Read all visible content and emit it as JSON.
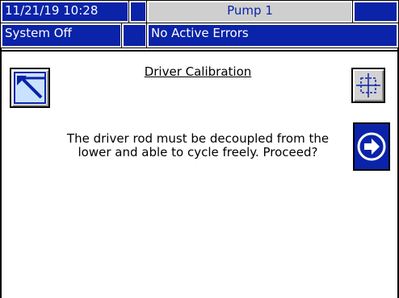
{
  "status_bar": {
    "datetime": "11/21/19 10:28",
    "pump_name": "Pump 1",
    "system_state": "System Off",
    "errors": "No Active Errors"
  },
  "screen": {
    "title": "Driver Calibration",
    "message_line1": "The driver rod must be decoupled from the",
    "message_line2": "lower and able to cycle freely. Proceed?"
  },
  "icons": {
    "exit": "exit-screen-icon",
    "center": "crosshair-icon",
    "next": "right-arrow-icon"
  },
  "colors": {
    "header_blue": "#0a23a8",
    "header_grey": "#cfcfcf",
    "exit_fill": "#c9e2ff"
  }
}
